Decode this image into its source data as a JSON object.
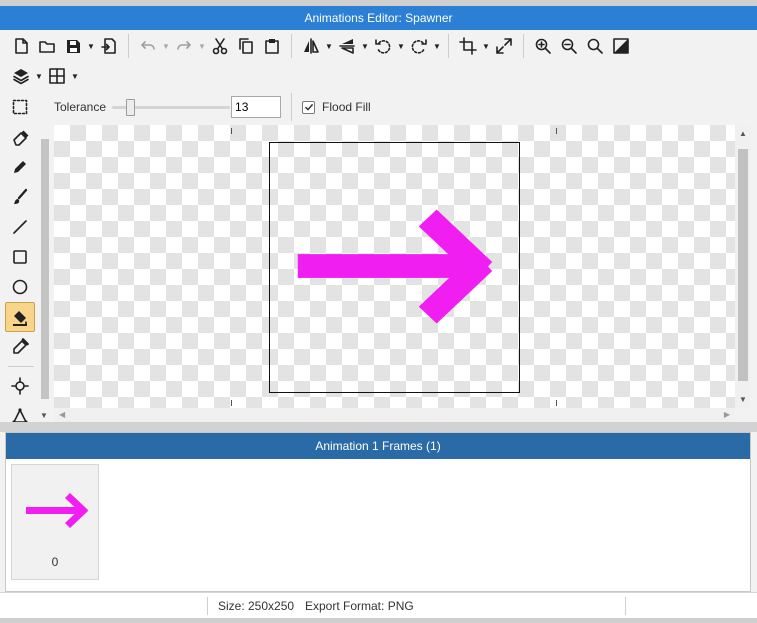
{
  "window": {
    "title": "Animations Editor: Spawner",
    "accent_color": "#2b7fd4",
    "panel_header_color": "#2a6aa6"
  },
  "toolbar": {
    "row1": [
      {
        "name": "new-file-icon",
        "dropdown": false,
        "disabled": false
      },
      {
        "name": "open-folder-icon",
        "dropdown": false,
        "disabled": false
      },
      {
        "name": "save-icon",
        "dropdown": true,
        "disabled": false
      },
      {
        "name": "import-icon",
        "dropdown": false,
        "disabled": false
      },
      {
        "name": "undo-icon",
        "dropdown": true,
        "disabled": true
      },
      {
        "name": "redo-icon",
        "dropdown": true,
        "disabled": true
      },
      {
        "name": "cut-icon",
        "dropdown": false,
        "disabled": false
      },
      {
        "name": "copy-icon",
        "dropdown": false,
        "disabled": false
      },
      {
        "name": "paste-icon",
        "dropdown": false,
        "disabled": false
      },
      {
        "name": "flip-horizontal-icon",
        "dropdown": true,
        "disabled": false
      },
      {
        "name": "flip-vertical-icon",
        "dropdown": true,
        "disabled": false
      },
      {
        "name": "rotate-left-icon",
        "dropdown": true,
        "disabled": false
      },
      {
        "name": "rotate-right-icon",
        "dropdown": true,
        "disabled": false
      },
      {
        "name": "crop-icon",
        "dropdown": true,
        "disabled": false
      },
      {
        "name": "resize-icon",
        "dropdown": false,
        "disabled": false
      },
      {
        "name": "zoom-in-icon",
        "dropdown": false,
        "disabled": false
      },
      {
        "name": "zoom-out-icon",
        "dropdown": false,
        "disabled": false
      },
      {
        "name": "zoom-fit-icon",
        "dropdown": false,
        "disabled": false
      },
      {
        "name": "toggle-background-icon",
        "dropdown": false,
        "disabled": false
      }
    ],
    "row2": [
      {
        "name": "layers-icon",
        "dropdown": true
      },
      {
        "name": "grid-icon",
        "dropdown": true
      }
    ]
  },
  "tools": [
    {
      "name": "select-tool-icon",
      "active": false
    },
    {
      "name": "eraser-tool-icon",
      "active": false
    },
    {
      "name": "pencil-tool-icon",
      "active": false
    },
    {
      "name": "brush-tool-icon",
      "active": false
    },
    {
      "name": "line-tool-icon",
      "active": false
    },
    {
      "name": "rectangle-tool-icon",
      "active": false
    },
    {
      "name": "ellipse-tool-icon",
      "active": false
    },
    {
      "name": "fill-tool-icon",
      "active": true
    },
    {
      "name": "eyedropper-tool-icon",
      "active": false
    },
    {
      "name": "origin-tool-icon",
      "active": false
    },
    {
      "name": "polygon-tool-icon",
      "active": false
    }
  ],
  "options": {
    "tolerance_label": "Tolerance",
    "tolerance_value": "13",
    "tolerance_fraction": 0.13,
    "flood_fill_label": "Flood Fill",
    "flood_fill_checked": true
  },
  "sprite": {
    "arrow_color": "#f01ef0"
  },
  "frames": {
    "title": "Animation 1 Frames (1)",
    "items": [
      {
        "index": "0"
      }
    ]
  },
  "status": {
    "size": "Size: 250x250",
    "export_format": "Export Format: PNG"
  }
}
